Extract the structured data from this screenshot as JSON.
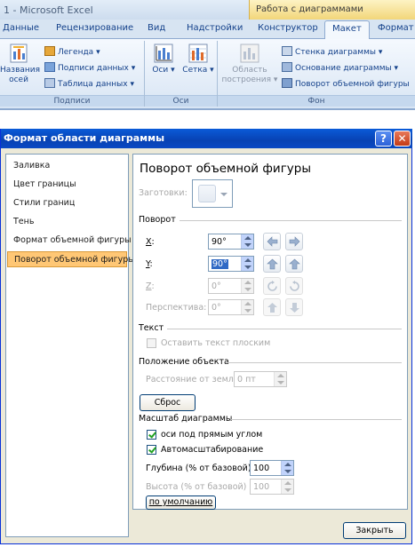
{
  "excel": {
    "window_title": "1 - Microsoft Excel",
    "contextual_tools": "Работа с диаграммами",
    "tabs": [
      {
        "label": "Данные"
      },
      {
        "label": "Рецензирование"
      },
      {
        "label": "Вид"
      },
      {
        "label": "Надстройки"
      },
      {
        "label": "Конструктор"
      },
      {
        "label": "Макет"
      },
      {
        "label": "Формат"
      }
    ],
    "active_tab": "Макет",
    "groups": {
      "labels": {
        "title": "Подписи",
        "chart_titles_line1": "Названия",
        "chart_titles_line2": "осей",
        "legend": "Легенда",
        "data_labels": "Подписи данных",
        "data_table": "Таблица данных"
      },
      "axes": {
        "title": "Оси",
        "axes_button": "Оси",
        "gridlines_button": "Сетка"
      },
      "background": {
        "title": "Фон",
        "plot_area_line1": "Область",
        "plot_area_line2": "построения",
        "chart_wall": "Стенка диаграммы",
        "chart_floor": "Основание диаграммы",
        "rotation_3d": "Поворот объемной фигуры"
      }
    }
  },
  "dialog": {
    "title": "Формат области диаграммы",
    "help_glyph": "?",
    "close_glyph": "✕",
    "nav": [
      {
        "label": "Заливка",
        "selected": false
      },
      {
        "label": "Цвет границы",
        "selected": false
      },
      {
        "label": "Стили границ",
        "selected": false
      },
      {
        "label": "Тень",
        "selected": false
      },
      {
        "label": "Формат объемной фигуры",
        "selected": false
      },
      {
        "label": "Поворот объемной фигуры",
        "selected": true
      }
    ],
    "panel": {
      "heading": "Поворот объемной фигуры",
      "presets_label": "Заготовки:",
      "rotation_section": "Поворот",
      "x": {
        "letter": "X",
        "suffix": ":",
        "value": "90°"
      },
      "y": {
        "letter": "Y",
        "suffix": ":",
        "value": "90°"
      },
      "z": {
        "letter": "Z",
        "suffix": ":",
        "value": "0°"
      },
      "perspective": {
        "label": "Перспектива:",
        "value": "0°"
      },
      "text_section": "Текст",
      "keep_text_flat": {
        "label": "Оставить текст плоским",
        "checked": false
      },
      "object_position_section": "Положение объекта",
      "distance_from_ground": {
        "label": "Расстояние от земли:",
        "value": "0 пт"
      },
      "reset_button": "Сброс",
      "chart_scale_section": "Масштаб диаграммы",
      "right_angle_axes": {
        "label": "оси под прямым углом",
        "checked": true
      },
      "autoscale": {
        "label": "Автомасштабирование",
        "checked": true
      },
      "depth": {
        "label": "Глубина (% от базовой)",
        "value": "100"
      },
      "height": {
        "label": "Высота (% от базовой)",
        "value": "100"
      },
      "default_button": "по умолчанию"
    },
    "close_button": "Закрыть"
  }
}
